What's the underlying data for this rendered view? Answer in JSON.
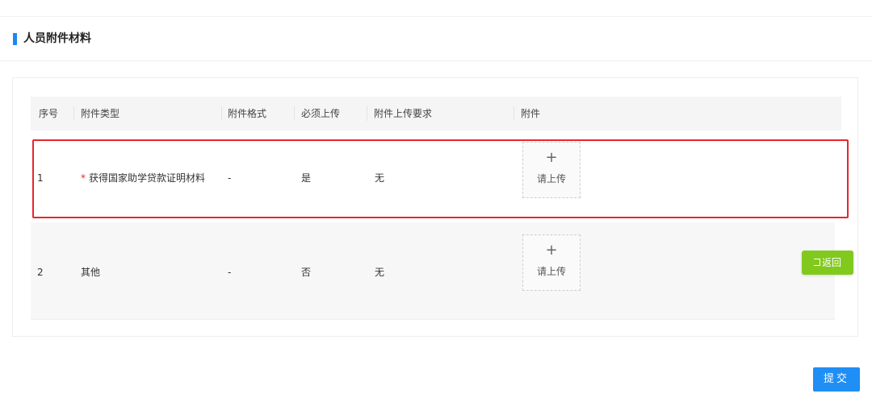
{
  "section": {
    "title": "人员附件材料"
  },
  "table": {
    "headers": {
      "index": "序号",
      "type": "附件类型",
      "format": "附件格式",
      "required": "必须上传",
      "requirement": "附件上传要求",
      "attachment": "附件"
    },
    "rows": [
      {
        "index": "1",
        "required_mark": "*",
        "type": "获得国家助学贷款证明材料",
        "format": "-",
        "required": "是",
        "requirement": "无",
        "upload_plus": "+",
        "upload_label": "请上传"
      },
      {
        "index": "2",
        "type": "其他",
        "format": "-",
        "required": "否",
        "requirement": "无",
        "upload_plus": "+",
        "upload_label": "请上传"
      }
    ]
  },
  "buttons": {
    "back": "返回",
    "submit": "提交"
  },
  "colors": {
    "accent": "#1e88f0",
    "highlight_border": "#e8262b",
    "back_button": "#82c91e",
    "submit_button": "#1f8ef5"
  },
  "icons": {
    "back": "return-icon",
    "upload": "plus-icon"
  }
}
